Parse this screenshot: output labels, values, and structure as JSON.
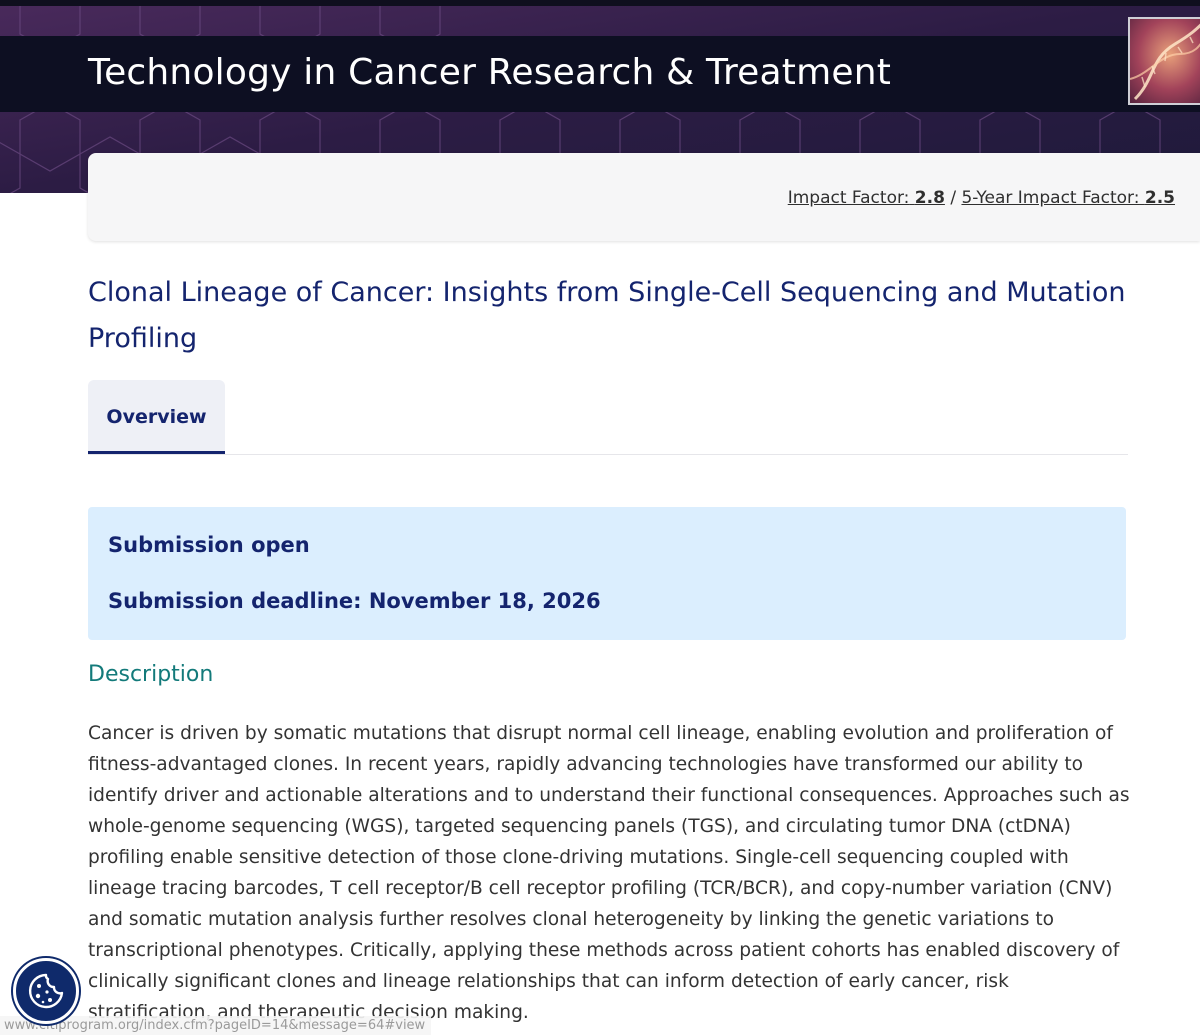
{
  "header": {
    "journal_title": "Technology in Cancer Research & Treatment",
    "cover_image": "journal-cover-dna-image"
  },
  "metrics": {
    "impact_factor_label": "Impact Factor:",
    "impact_factor_value": "2.8",
    "separator": "/",
    "five_year_label": "5-Year Impact Factor:",
    "five_year_value": "2.5"
  },
  "article": {
    "title": "Clonal Lineage of Cancer: Insights from Single-Cell Sequencing and Mutation Profiling"
  },
  "tabs": [
    {
      "label": "Overview",
      "active": true
    }
  ],
  "submission": {
    "status": "Submission open",
    "deadline": "Submission deadline: November 18, 2026"
  },
  "description": {
    "heading": "Description",
    "body": "Cancer is driven by somatic mutations that disrupt normal cell lineage, enabling evolution and proliferation of fitness-advantaged clones. In recent years, rapidly advancing technologies have transformed our ability to identify driver and actionable alterations and to understand their functional consequences. Approaches such as whole-genome sequencing (WGS), targeted sequencing panels (TGS), and circulating tumor DNA (ctDNA) profiling enable sensitive detection of those clone-driving mutations. Single-cell sequencing coupled with lineage tracing barcodes, T cell receptor/B cell receptor profiling (TCR/BCR), and copy-number variation (CNV) and somatic mutation analysis further resolves clonal heterogeneity by linking the genetic variations to transcriptional phenotypes. Critically, applying these methods across patient cohorts has enabled discovery of clinically significant clones and lineage relationships that can inform detection of early cancer, risk stratification, and therapeutic decision making."
  },
  "status_bar": {
    "url": "www.citiprogram.org/index.cfm?pageID=14&message=64#view"
  },
  "cookie_button": {
    "icon": "cookie-icon"
  },
  "colors": {
    "brand_navy": "#14246e",
    "description_teal": "#137a7a",
    "submission_bg": "#dbeefe",
    "banner_dark": "#0d0f22",
    "banner_purple": "#2a1a3c"
  }
}
